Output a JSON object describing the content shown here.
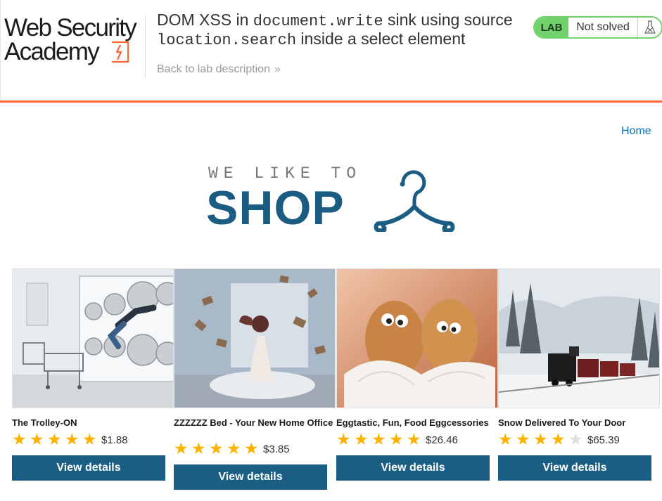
{
  "header": {
    "logo_line1": "Web Security",
    "logo_line2": "Academy",
    "title_1": "DOM XSS in ",
    "title_code_1": "document.write",
    "title_2": " sink using source ",
    "title_code_2": "location.search",
    "title_3": " inside a select element",
    "back_link": "Back to lab description",
    "back_chevron": "»",
    "status_badge": "LAB",
    "status_text": "Not solved"
  },
  "nav": {
    "home": "Home"
  },
  "banner": {
    "line1": "WE LIKE TO",
    "line2": "SHOP"
  },
  "products": [
    {
      "name": "The Trolley-ON",
      "rating": 5,
      "price": "$1.88",
      "button": "View details"
    },
    {
      "name": "ZZZZZZ Bed - Your New Home Office",
      "rating": 5,
      "price": "$3.85",
      "button": "View details"
    },
    {
      "name": "Eggtastic, Fun, Food Eggcessories",
      "rating": 5,
      "price": "$26.46",
      "button": "View details"
    },
    {
      "name": "Snow Delivered To Your Door",
      "rating": 4,
      "price": "$65.39",
      "button": "View details"
    }
  ],
  "colors": {
    "accent_orange": "#ff6633",
    "lab_green": "#70d16d",
    "shop_blue": "#1b5c82",
    "button_blue": "#1a5f83",
    "star_gold": "#fbb300",
    "link_blue": "#0071bc"
  },
  "icons": {
    "logo_mark": "lightning-bracket-icon",
    "status_flask": "flask-icon",
    "banner_hanger": "hanger-icon",
    "rating": "star-icon"
  }
}
